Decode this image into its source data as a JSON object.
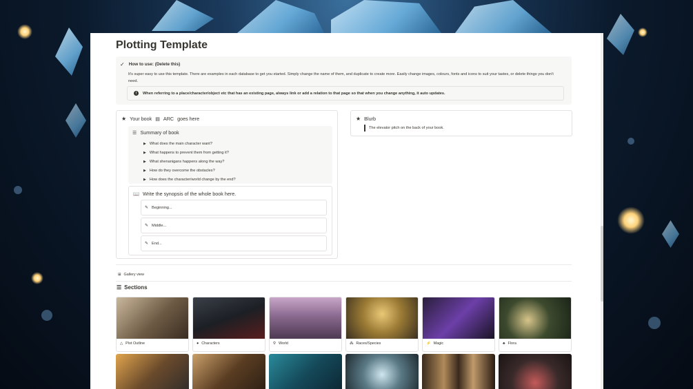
{
  "page": {
    "title": "Plotting Template"
  },
  "how_to": {
    "heading": "How to use: (Delete this)",
    "body": "It's super easy to use this template. There are examples in each database to get you started. Simply change the name of them, and duplicate to create more. Easily change images, colours, fonts and icons to suit your tastes, or delete things you don't need.",
    "notice_prefix": "When referring to a place/character/object etc that has an existing page, always link or add a relation to that page so that when you change anything, it auto updates."
  },
  "book": {
    "prefix": "Your book",
    "arc": "ARC",
    "suffix": "goes here",
    "summary_title": "Summary of book",
    "questions": [
      "What does the main character want?",
      "What happens to prevent them from getting it?",
      "What shenanigans happens along the way?",
      "How do they overcome the obstacles?",
      "How does the character/world change by the end?"
    ],
    "synopsis_title": "Write the synopsis of the whole book here.",
    "synopsis_parts": [
      "Beginning...",
      "Middle...",
      "End..."
    ]
  },
  "blurb": {
    "title": "Blurb",
    "text": "The elevator pitch on the back of your book."
  },
  "gallery": {
    "view_label": "Gallery view",
    "sections_title": "Sections",
    "tiles": [
      {
        "label": "Plot Outline",
        "icon": "warning-triangle-icon"
      },
      {
        "label": "Characters",
        "icon": "person-icon"
      },
      {
        "label": "World",
        "icon": "location-pin-icon"
      },
      {
        "label": "Races/Species",
        "icon": "group-icon"
      },
      {
        "label": "Magic",
        "icon": "magic-wand-icon"
      },
      {
        "label": "Flora",
        "icon": "plant-icon"
      }
    ]
  },
  "colors": {
    "text": "#37352f",
    "callout_bg": "#f7f7f5",
    "border": "#e3e2e0"
  }
}
